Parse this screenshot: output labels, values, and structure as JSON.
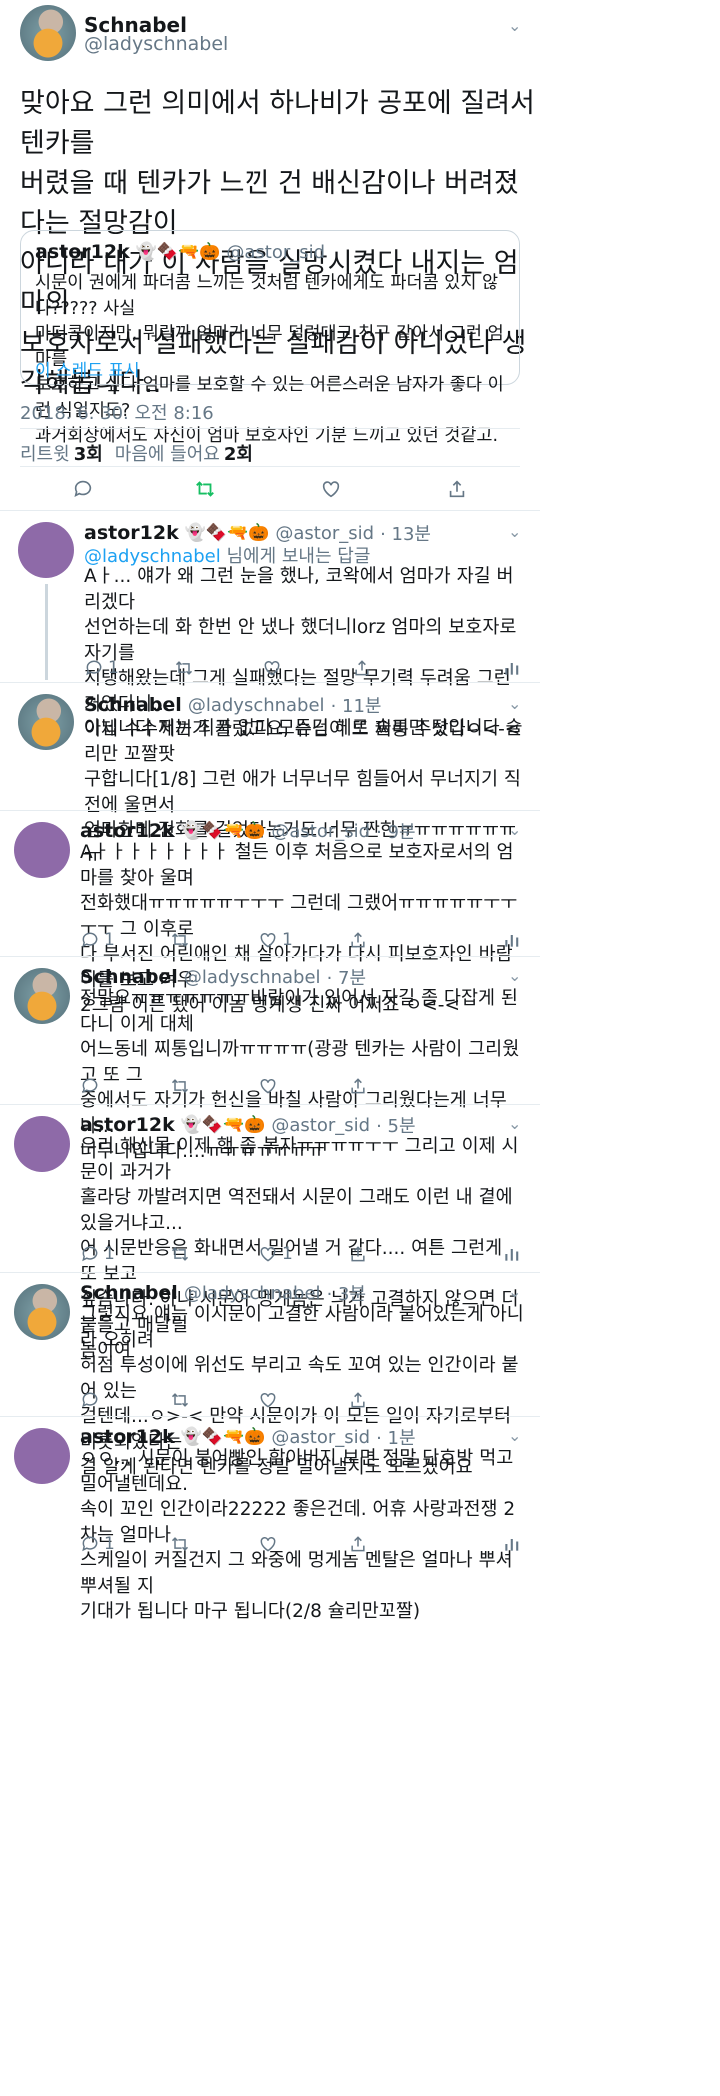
{
  "main_tweet": {
    "name": "Schnabel",
    "handle": "@ladyschnabel",
    "text": "맞아요 그런 의미에서 하나비가 공포에 질려서 텐카를\n버렸을 때 텐카가 느낀 건 배신감이나 버려졌다는 절망감이\n아니라 내가 이 사람을 실망시켰다 내지는 엄마의\n보호자로서 실패했다는 실패감이 아니었나 생각해봅니다..",
    "quote": {
      "name": "astor12k",
      "emojis": "👻🍫🔫🎃",
      "handle": "@astor_sid",
      "text": "시문이 권에게 파더콤 느끼는 것처럼 텐카에게도 파더콤 있지 않나????? 사실\n마더콤이지만, 뭐랄까 엄마가 너무 덜렁대고 친구 같아서 그런 엄마를\n보호하고 싶다 엄마를 보호할 수 있는 어른스러운 남자가 좋다 이런 식일지도?\n과거회상에서도 자신이 엄마 보호자인 기분 느끼고 있던 것같고.",
      "show_thread": "이 스레드 표시"
    },
    "timestamp": "2018. 6. 30. 오전 8:16",
    "retweet_label": "리트윗",
    "retweet_count": "3회",
    "like_label": "마음에 들어요",
    "like_count": "2회"
  },
  "replies": [
    {
      "name": "astor12k",
      "emojis": "👻🍫🔫🎃",
      "handle": "@astor_sid",
      "time": "· 13분",
      "replying_to": "@ladyschnabel",
      "replying_suffix": " 님에게 보내는 답글",
      "text": "Aㅏ... 얘가 왜 그런 눈을 했나, 코왁에서 엄마가 자길 버리겠다\n선언하는데 화 한번 안 냈나 했더니lorz 엄마의 보호자로 자기를\n지탱해왔는데 그게 실패했다는 절망 무기력 두려움 그런 거였다니...\n이제 수수께끼가 풀렸고요, 슈님이 또 찌통 주셨다ㅇ<-<",
      "reply_count": "1",
      "like_count": ""
    },
    {
      "name": "Schnabel",
      "emojis": "",
      "handle": "@ladyschnabel",
      "time": "· 11분",
      "text": "아닙니다 저는 죄가 없다 모든건 헤르 슐리만 탓입니다 슐리만 꼬짤팟\n구합니다[1/8] 그런 애가 너무너무 힘들어서 무너지기 직전에 울면서\n엄마한테 전화를 걸었다는거도 너무 짠한ㅠㅠㅠㅠㅠㅠㅠㅠ",
      "reply_count": "",
      "like_count": ""
    },
    {
      "name": "astor12k",
      "emojis": "👻🍫🔫🎃",
      "handle": "@astor_sid",
      "time": "· 9분",
      "text": "Aㅏㅏㅏㅏㅏㅏㅏㅏ 철든 이후 처음으로 보호자로서의 엄마를 찾아 울며\n전화했대ㅠㅠㅠㅠㅠㅜㅜㅜ 그런데 그랬어ㅠㅠㅠㅠㅠㅜㅜㅜㅜ 그 이후로\n다 부서진 어린애인 채 살아가다가 다시 피보호자인 바람이를 보고 겨우\n2그람 어른 됐어 이놈 멍게생 진짜 어쩌죠 ㅇ<-<",
      "reply_count": "1",
      "like_count": "1"
    },
    {
      "name": "Schnabel",
      "emojis": "",
      "handle": "@ladyschnabel",
      "time": "· 7분",
      "text": "정말요ㅠㅠㅠㅠㅠㅠㅠ바람이가 있어서 자길 좀 다잡게 된다니 이게 대체\n어느동네 찌통입니까ㅠㅠㅠㅠ(광광 텐카는 사람이 그리웠고 또 그\n중에서도 자기가 헌신을 바칠 사람이 그리웠다는게 너무나...\n너무나입니다....ㅠㅠㅠㅠㅠㅠㅠ",
      "reply_count": "",
      "like_count": ""
    },
    {
      "name": "astor12k",
      "emojis": "👻🍫🔫🎃",
      "handle": "@astor_sid",
      "time": "· 5분",
      "text": "우리 해산물 이제 햄 좀 볶자ㅠㅠㅠㅠㅜㅜ 그리고 이제 시문이 과거가\n홀라당 까발려지면 역전돼서 시문이 그래도 이런 내 곁에 있을거냐고...\n어 시문반응은 화내면서 밀어낼 거 같다.... 여튼 그런게 또 보고\n싶슴나다. 아냐 시문아 멍게놈은 늬가 고결하지 않으면 더 붙들고 매달릴\n놈이여",
      "reply_count": "1",
      "like_count": "1"
    },
    {
      "name": "Schnabel",
      "emojis": "",
      "handle": "@ladyschnabel",
      "time": "· 3분",
      "text": "그렇지요 얘는 이시문이 고결한 사람이라 붙어있는게 아니라 오히려\n허점 투성이에 위선도 부리고 속도 꼬여 있는 인간이라 붙어 있는\n걸텐데...ㅇ>-< 만약 시문이가 이 모든 일이 자기로부터 비롯되었다는\n걸 알게 된다면 텐카를 정말 밀어낼지도 모르겠어요",
      "reply_count": "",
      "like_count": ""
    },
    {
      "name": "astor12k",
      "emojis": "👻🍫🔫🎃",
      "handle": "@astor_sid",
      "time": "· 1분",
      "text": "ㅇㅇ... 시문이 붕어빵인 할아버지 보면 정말 단호박 먹고 밀어낼텐데요.\n속이 꼬인 인간이라22222 좋은건데. 어휴 사랑과전쟁 2차는 얼마나\n스케일이 커질건지 그 와중에 멍게놈 멘탈은 얼마나 뿌셔뿌셔될 지\n기대가 됩니다 마구 됩니다(2/8 슐리만꼬짤)",
      "reply_count": "1",
      "like_count": ""
    }
  ],
  "icons": [
    "chevron-down-icon",
    "reply-icon",
    "retweet-icon",
    "like-icon",
    "share-icon",
    "analytics-icon"
  ],
  "colors": {
    "accent": "#1da1f2",
    "retweet_green": "#17bf63",
    "muted": "#657786",
    "border": "#e6ecf0"
  }
}
